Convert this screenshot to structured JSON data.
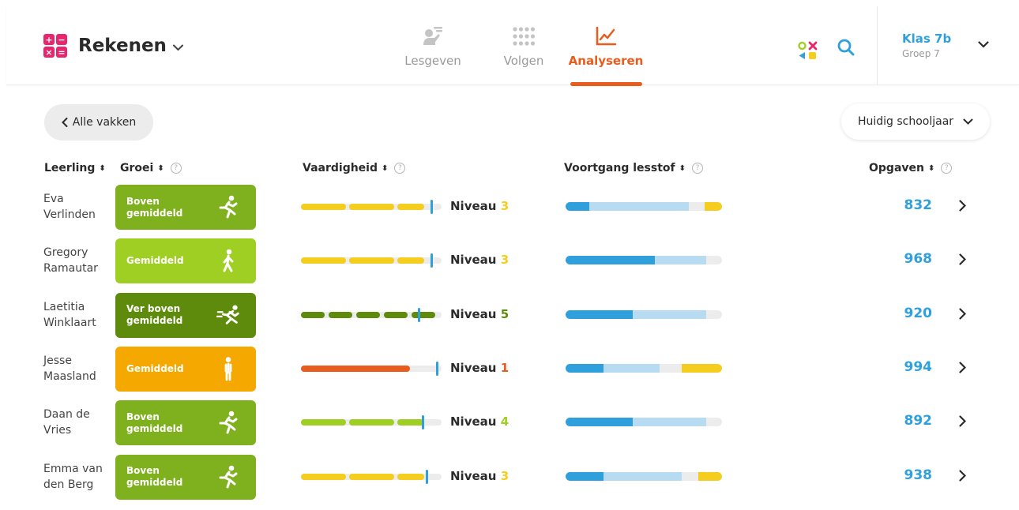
{
  "header": {
    "app_title": "Rekenen",
    "calc_symbols": [
      "+",
      "−",
      "×",
      "="
    ],
    "nav": [
      {
        "label": "Lesgeven",
        "icon": "teacher-icon"
      },
      {
        "label": "Volgen",
        "icon": "dots-grid-icon"
      },
      {
        "label": "Analyseren",
        "icon": "line-chart-icon",
        "active": true
      }
    ],
    "class_title": "Klas 7b",
    "class_subtitle": "Groep 7"
  },
  "toolbar": {
    "back_label": "Alle vakken",
    "year_label": "Huidig schooljaar"
  },
  "columns": {
    "student": "Leerling",
    "growth": "Groei",
    "skill": "Vaardigheid",
    "progress": "Voortgang lesstof",
    "exercises": "Opgaven"
  },
  "level_prefix": "Niveau",
  "colors": {
    "accent": "#e85d1d",
    "link": "#2fa0dc",
    "above_avg": "#7fb01e",
    "avg": "#9fcf22",
    "far_above": "#5f8b0c",
    "avg_orange": "#f4a800",
    "yellow": "#f5cd1e",
    "red": "#e85d1d",
    "progress_done": "#2fa0dc",
    "progress_light": "#b7dcf1"
  },
  "students": [
    {
      "name": "Eva Verlinden",
      "growth": "Boven gemiddeld",
      "growth_icon": "running-person-icon",
      "level": "3",
      "skill_value": 0.92,
      "progress_done": 0.15,
      "progress_light": 0.64,
      "progress_yellow": 0.1,
      "exercises": "832"
    },
    {
      "name": "Gregory Ramautar",
      "growth": "Gemiddeld",
      "growth_icon": "walking-person-icon",
      "level": "3",
      "skill_value": 0.92,
      "progress_done": 0.57,
      "progress_light": 0.33,
      "progress_yellow": 0,
      "exercises": "968"
    },
    {
      "name": "Laetitia Winklaart",
      "growth": "Ver boven gemiddeld",
      "growth_icon": "sprinting-person-icon",
      "level": "5",
      "skill_value": 0.83,
      "progress_done": 0.43,
      "progress_light": 0.47,
      "progress_yellow": 0,
      "exercises": "920"
    },
    {
      "name": "Jesse Maasland",
      "growth": "Gemiddeld",
      "growth_icon": "standing-person-icon",
      "level": "1",
      "skill_value": 0.96,
      "progress_done": 0.24,
      "progress_light": 0.36,
      "progress_yellow": 0.25,
      "exercises": "994"
    },
    {
      "name": "Daan de Vries",
      "growth": "Boven gemiddeld",
      "growth_icon": "running-person-icon",
      "level": "4",
      "skill_value": 0.86,
      "progress_done": 0.43,
      "progress_light": 0.47,
      "progress_yellow": 0,
      "exercises": "892"
    },
    {
      "name": "Emma van den Berg",
      "growth": "Boven gemiddeld",
      "growth_icon": "running-person-icon",
      "level": "3",
      "skill_value": 0.89,
      "progress_done": 0.24,
      "progress_light": 0.5,
      "progress_yellow": 0.14,
      "exercises": "938"
    }
  ]
}
